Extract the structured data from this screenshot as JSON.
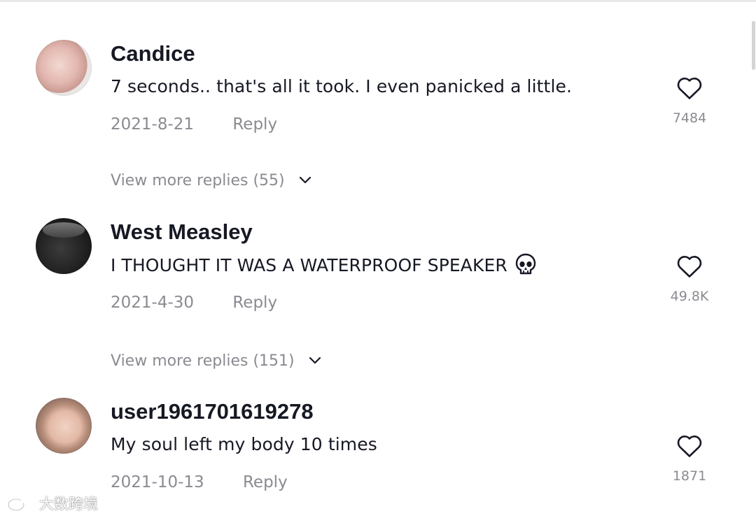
{
  "comments": [
    {
      "username": "Candice",
      "text": "7 seconds.. that's all it took. I even panicked a little.",
      "date": "2021-8-21",
      "reply_label": "Reply",
      "likes": "7484",
      "view_more": "View more replies (55)"
    },
    {
      "username": "West Measley",
      "text": "I THOUGHT IT WAS A WATERPROOF SPEAKER",
      "emoji": "skull-icon",
      "date": "2021-4-30",
      "reply_label": "Reply",
      "likes": "49.8K",
      "view_more": "View more replies (151)"
    },
    {
      "username": "user1961701619278",
      "text": "My soul left my body 10 times",
      "date": "2021-10-13",
      "reply_label": "Reply",
      "likes": "1871"
    }
  ],
  "watermark": {
    "text": "大数跨境",
    "icon": "weibo-logo-icon"
  },
  "colors": {
    "text": "#161823",
    "secondary": "#8a8b91",
    "background": "#ffffff"
  }
}
